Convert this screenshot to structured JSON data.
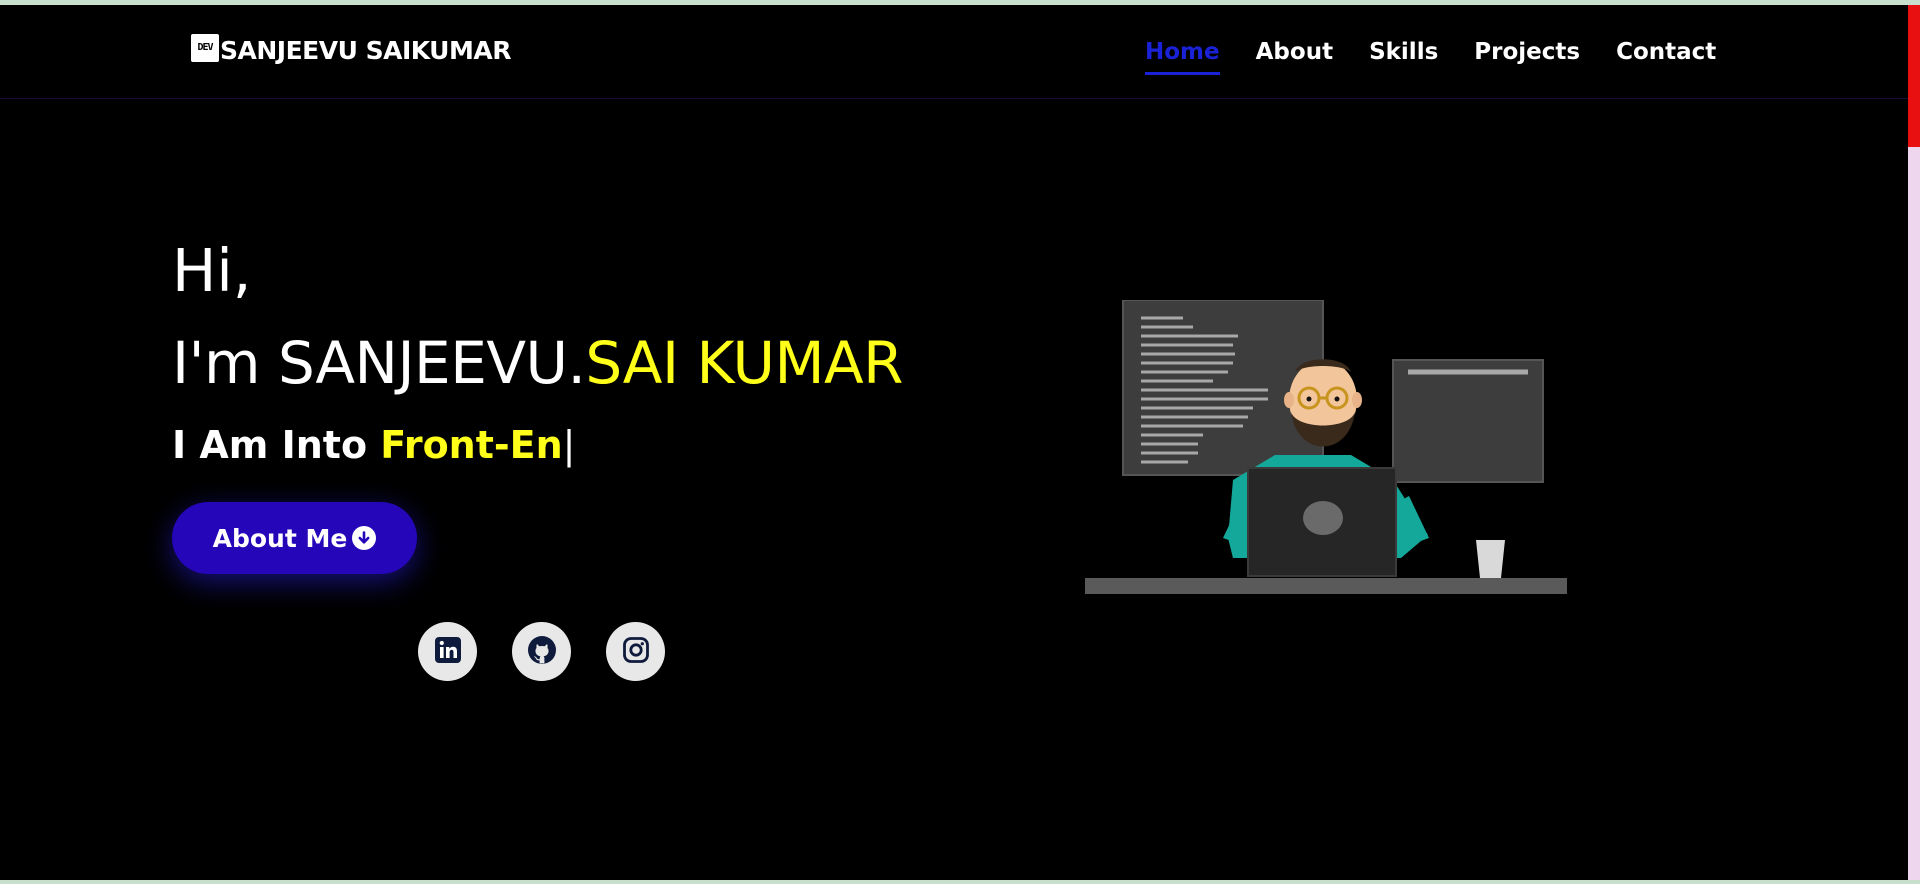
{
  "brand": {
    "badge_text": "DEV",
    "name": "SANJEEVU SAIKUMAR"
  },
  "nav": {
    "items": [
      {
        "label": "Home",
        "active": true
      },
      {
        "label": "About",
        "active": false
      },
      {
        "label": "Skills",
        "active": false
      },
      {
        "label": "Projects",
        "active": false
      },
      {
        "label": "Contact",
        "active": false
      }
    ]
  },
  "hero": {
    "greeting": "Hi,",
    "name_prefix": "I'm SANJEEVU.",
    "name_highlight": "SAI KUMAR",
    "typed_prefix": "I Am Into ",
    "typed_value": "Front-En",
    "cursor": "|",
    "button_label": "About Me",
    "button_icon": "arrow-down-circle-icon"
  },
  "social": [
    {
      "name": "linkedin",
      "icon": "linkedin-icon"
    },
    {
      "name": "github",
      "icon": "github-icon"
    },
    {
      "name": "instagram",
      "icon": "instagram-icon"
    }
  ],
  "colors": {
    "background": "#000000",
    "accent_blue": "#1a22d8",
    "button_bg": "#2506b8",
    "highlight_yellow": "#ffff1a",
    "text_white": "#ffffff",
    "scroll_thumb": "#e81010"
  }
}
